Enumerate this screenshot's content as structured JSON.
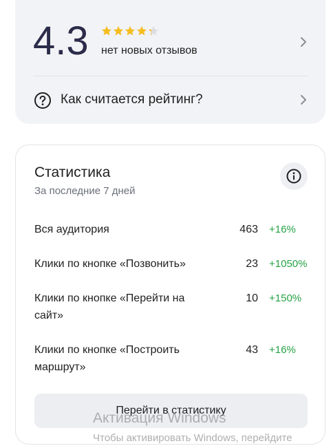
{
  "rating": {
    "score": "4.3",
    "stars_value": 4.3,
    "stars_max": 5,
    "star_color": "#f5bd1f",
    "subtitle": "нет новых отзывов",
    "how_calculated_label": "Как считается рейтинг?",
    "how_icon": "question-circle-icon"
  },
  "stats": {
    "title": "Статистика",
    "period": "За последние 7 дней",
    "info_icon": "info-circle-icon",
    "rows": [
      {
        "label": "Вся аудитория",
        "value": "463",
        "change": "+16%"
      },
      {
        "label": "Клики по кнопке «Позвонить»",
        "value": "23",
        "change": "+1050%"
      },
      {
        "label": "Клики по кнопке «Перейти на сайт»",
        "value": "10",
        "change": "+150%"
      },
      {
        "label": "Клики по кнопке «Построить маршрут»",
        "value": "43",
        "change": "+16%"
      }
    ],
    "positive_color": "#25a244",
    "button_label": "Перейти в статистику"
  },
  "watermark": {
    "title": "Активация Windows",
    "subtitle": "Чтобы активировать Windows, перейдите"
  }
}
